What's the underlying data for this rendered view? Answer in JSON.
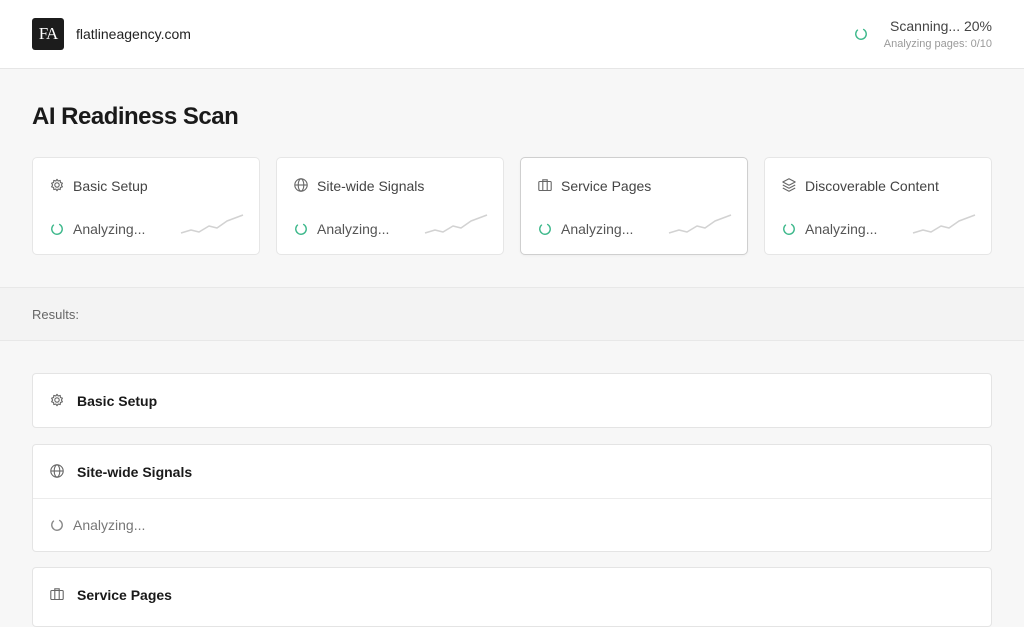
{
  "header": {
    "logo_text": "FA",
    "domain": "flatlineagency.com",
    "scan_status": "Scanning... 20%",
    "scan_substatus": "Analyzing pages: 0/10",
    "scan_progress_percent": 20
  },
  "page": {
    "title": "AI Readiness Scan"
  },
  "cards": [
    {
      "title": "Basic Setup",
      "icon": "gear-icon",
      "status": "Analyzing..."
    },
    {
      "title": "Site-wide Signals",
      "icon": "globe-icon",
      "status": "Analyzing..."
    },
    {
      "title": "Service Pages",
      "icon": "briefcase-icon",
      "status": "Analyzing..."
    },
    {
      "title": "Discoverable Content",
      "icon": "layers-icon",
      "status": "Analyzing..."
    }
  ],
  "results": {
    "label": "Results:",
    "sections": [
      {
        "title": "Basic Setup",
        "icon": "gear-icon"
      },
      {
        "title": "Site-wide Signals",
        "icon": "globe-icon",
        "status": "Analyzing..."
      },
      {
        "title": "Service Pages",
        "icon": "briefcase-icon"
      }
    ]
  },
  "colors": {
    "spinner_active": "#3db88b",
    "spinner_idle": "#8a8a8a",
    "sparkline": "#d2d2d2"
  }
}
